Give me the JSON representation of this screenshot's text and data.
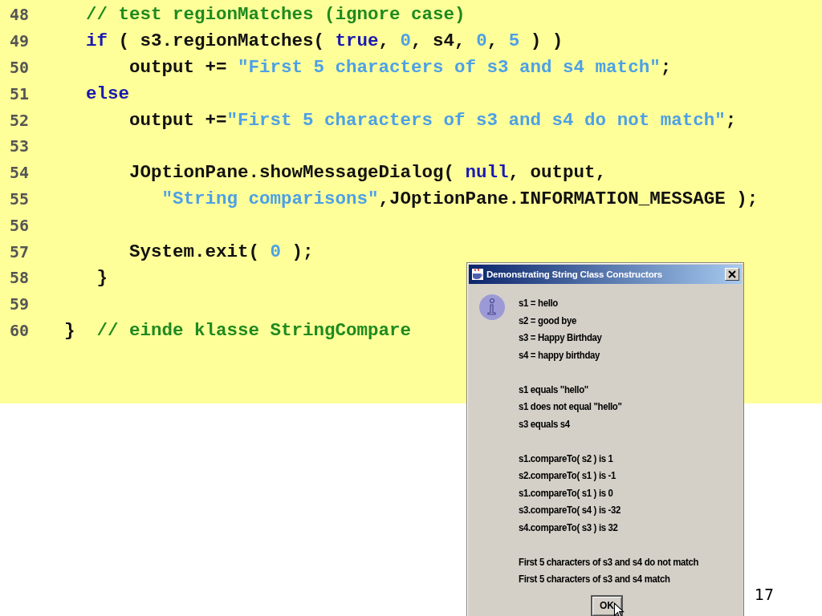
{
  "code": {
    "lines": [
      {
        "number": "48",
        "tokens": [
          {
            "kind": "comment",
            "text": "    // test regionMatches (ignore case)"
          }
        ]
      },
      {
        "number": "49",
        "tokens": [
          {
            "kind": "keyword",
            "text": "    if"
          },
          {
            "kind": "plain",
            "text": " ( s3.regionMatches( "
          },
          {
            "kind": "keyword",
            "text": "true"
          },
          {
            "kind": "plain",
            "text": ", "
          },
          {
            "kind": "number",
            "text": "0"
          },
          {
            "kind": "plain",
            "text": ", s4, "
          },
          {
            "kind": "number",
            "text": "0"
          },
          {
            "kind": "plain",
            "text": ", "
          },
          {
            "kind": "number",
            "text": "5"
          },
          {
            "kind": "plain",
            "text": " ) )"
          }
        ]
      },
      {
        "number": "50",
        "tokens": [
          {
            "kind": "plain",
            "text": "        output += "
          },
          {
            "kind": "string",
            "text": "\"First 5 characters of s3 and s4 match\""
          },
          {
            "kind": "plain",
            "text": ";"
          }
        ]
      },
      {
        "number": "51",
        "tokens": [
          {
            "kind": "keyword",
            "text": "    else"
          }
        ]
      },
      {
        "number": "52",
        "tokens": [
          {
            "kind": "plain",
            "text": "        output +="
          },
          {
            "kind": "string",
            "text": "\"First 5 characters of s3 and s4 do not match\""
          },
          {
            "kind": "plain",
            "text": ";"
          }
        ]
      },
      {
        "number": "53"
      },
      {
        "number": "54",
        "tokens": [
          {
            "kind": "plain",
            "text": "        JOptionPane.showMessageDialog( "
          },
          {
            "kind": "keyword",
            "text": "null"
          },
          {
            "kind": "plain",
            "text": ", output,"
          }
        ]
      },
      {
        "number": "55",
        "tokens": [
          {
            "kind": "string",
            "text": "           \"String comparisons\""
          },
          {
            "kind": "plain",
            "text": ",JOptionPane.INFORMATION_MESSAGE );"
          }
        ]
      },
      {
        "number": "56"
      },
      {
        "number": "57",
        "tokens": [
          {
            "kind": "plain",
            "text": "        System.exit( "
          },
          {
            "kind": "number",
            "text": "0"
          },
          {
            "kind": "plain",
            "text": " );"
          }
        ]
      },
      {
        "number": "58",
        "tokens": [
          {
            "kind": "plain",
            "text": "     }"
          }
        ]
      },
      {
        "number": "59"
      },
      {
        "number": "60",
        "tokens": [
          {
            "kind": "plain",
            "text": "  }  "
          },
          {
            "kind": "comment",
            "text": "// einde klasse StringCompare"
          }
        ]
      }
    ]
  },
  "dialog": {
    "title": "Demonstrating String Class Constructors",
    "message_groups": [
      [
        "s1 = hello",
        "s2 = good bye",
        "s3 = Happy Birthday",
        "s4 = happy birthday"
      ],
      [
        "s1 equals \"hello\"",
        "s1 does not equal \"hello\"",
        "s3 equals s4"
      ],
      [
        "s1.compareTo( s2 ) is 1",
        "s2.compareTo( s1 ) is -1",
        "s1.compareTo( s1 ) is 0",
        "s3.compareTo( s4 ) is -32",
        "s4.compareTo( s3 ) is 32"
      ],
      [
        "First 5 characters of s3 and s4 do not match",
        "First 5 characters of s3 and s4 match"
      ]
    ],
    "button": "OK"
  },
  "page_number": "17"
}
